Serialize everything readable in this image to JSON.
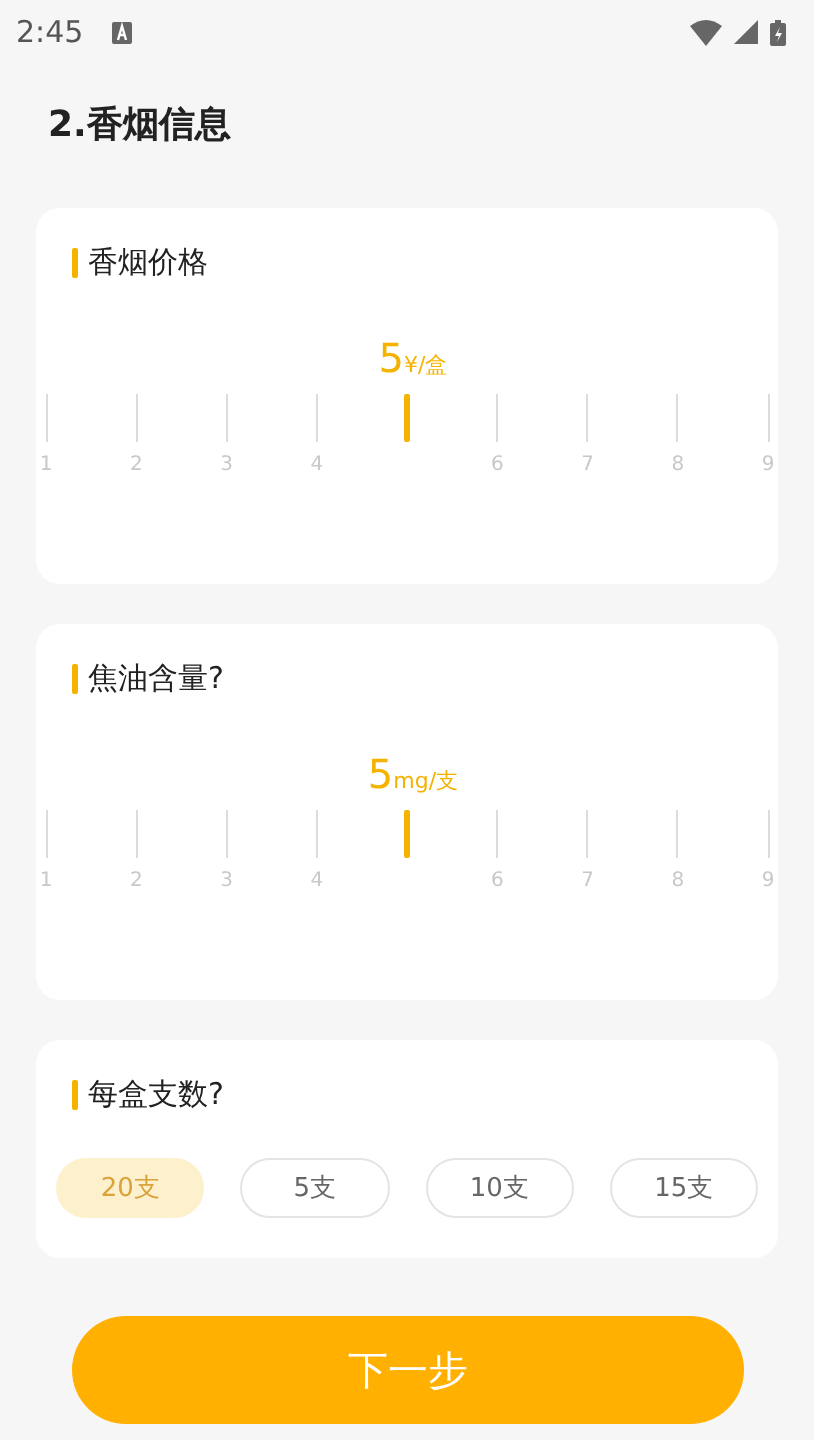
{
  "status_bar": {
    "time": "2:45"
  },
  "title": "2.香烟信息",
  "rulers": [
    {
      "label": "香烟价格",
      "value": "5",
      "unit": "¥/盒",
      "ticks": [
        {
          "label": "1",
          "selected": false
        },
        {
          "label": "2",
          "selected": false
        },
        {
          "label": "3",
          "selected": false
        },
        {
          "label": "4",
          "selected": false
        },
        {
          "selected": true
        },
        {
          "label": "6",
          "selected": false
        },
        {
          "label": "7",
          "selected": false
        },
        {
          "label": "8",
          "selected": false
        },
        {
          "label": "9",
          "selected": false
        }
      ]
    },
    {
      "label": "焦油含量?",
      "value": "5",
      "unit": "mg/支",
      "ticks": [
        {
          "label": "1",
          "selected": false
        },
        {
          "label": "2",
          "selected": false
        },
        {
          "label": "3",
          "selected": false
        },
        {
          "label": "4",
          "selected": false
        },
        {
          "selected": true
        },
        {
          "label": "6",
          "selected": false
        },
        {
          "label": "7",
          "selected": false
        },
        {
          "label": "8",
          "selected": false
        },
        {
          "label": "9",
          "selected": false
        }
      ]
    }
  ],
  "choice": {
    "label": "每盒支数?",
    "options": [
      {
        "label": "20支",
        "selected": true
      },
      {
        "label": "5支",
        "selected": false
      },
      {
        "label": "10支",
        "selected": false
      },
      {
        "label": "15支",
        "selected": false
      }
    ]
  },
  "next_button": "下一步"
}
